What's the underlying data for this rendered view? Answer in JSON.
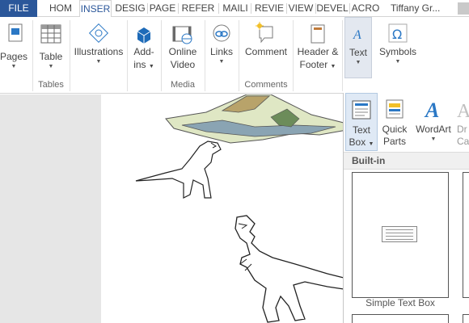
{
  "tabs": [
    {
      "label": "FILE"
    },
    {
      "label": "HOM"
    },
    {
      "label": "INSER"
    },
    {
      "label": "DESIG"
    },
    {
      "label": "PAGE"
    },
    {
      "label": "REFER"
    },
    {
      "label": "MAILI"
    },
    {
      "label": "REVIE"
    },
    {
      "label": "VIEW"
    },
    {
      "label": "DEVEL"
    },
    {
      "label": "ACRO"
    }
  ],
  "user": {
    "name": "Tiffany Gr..."
  },
  "ribbon": {
    "pages": "Pages",
    "table": "Table",
    "illustrations": "Illustrations",
    "addins_1": "Add-",
    "addins_2": "ins",
    "online_video_1": "Online",
    "online_video_2": "Video",
    "links": "Links",
    "comment": "Comment",
    "header_footer_1": "Header &",
    "header_footer_2": "Footer",
    "text": "Text",
    "symbols": "Symbols",
    "groups": {
      "tables": "Tables",
      "media": "Media",
      "comments": "Comments"
    }
  },
  "gallery": {
    "text_box_1": "Text",
    "text_box_2": "Box",
    "quick_parts_1": "Quick",
    "quick_parts_2": "Parts",
    "wordart": "WordArt",
    "dropcap_1": "Dr",
    "dropcap_2": "Ca",
    "section_header": "Built-in",
    "items": [
      {
        "label": "Simple Text Box"
      }
    ]
  },
  "colors": {
    "accent": "#2b579a",
    "ribbon_bg": "#ffffff",
    "selected_bg": "#dfe9f5"
  }
}
